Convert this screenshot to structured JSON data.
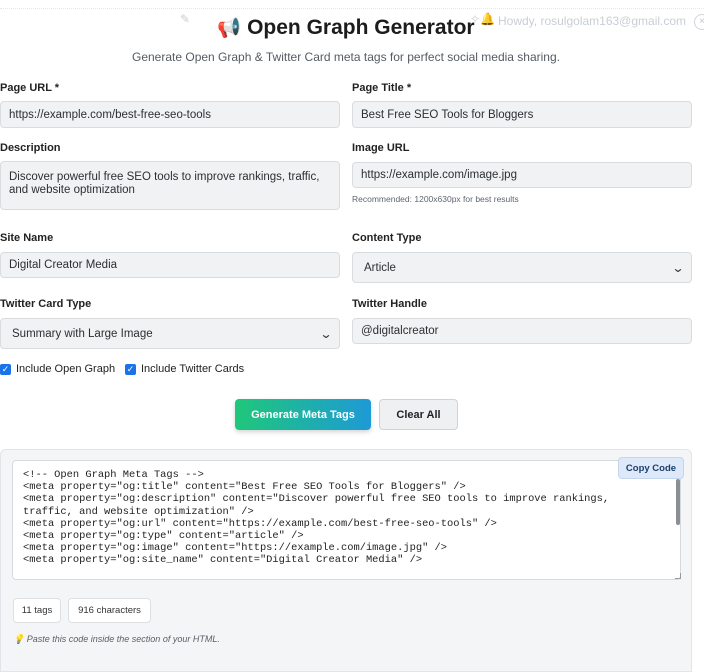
{
  "page": {
    "title": "Open Graph Generator",
    "title_icon": "📢",
    "subtitle": "Generate Open Graph & Twitter Card meta tags for perfect social media sharing.",
    "account_text": "Howdy, rosulgolam163@gmail.com"
  },
  "fields": {
    "page_url": {
      "label": "Page URL *",
      "value": "https://example.com/best-free-seo-tools"
    },
    "page_title": {
      "label": "Page Title *",
      "value": "Best Free SEO Tools for Bloggers"
    },
    "description": {
      "label": "Description",
      "value": "Discover powerful free SEO tools to improve rankings, traffic, and website optimization"
    },
    "image_url": {
      "label": "Image URL",
      "value": "https://example.com/image.jpg",
      "hint": "Recommended: 1200x630px for best results"
    },
    "site_name": {
      "label": "Site Name",
      "value": "Digital Creator Media"
    },
    "content_type": {
      "label": "Content Type",
      "value": "Article"
    },
    "twitter_card_type": {
      "label": "Twitter Card Type",
      "value": "Summary with Large Image"
    },
    "twitter_handle": {
      "label": "Twitter Handle",
      "value": "@digitalcreator"
    }
  },
  "checkboxes": {
    "open_graph": {
      "label": "Include Open Graph",
      "checked": true
    },
    "twitter_cards": {
      "label": "Include Twitter Cards",
      "checked": true
    }
  },
  "buttons": {
    "generate": "Generate Meta Tags",
    "clear": "Clear All",
    "copy": "Copy Code"
  },
  "output": {
    "code": "<!-- Open Graph Meta Tags -->\n<meta property=\"og:title\" content=\"Best Free SEO Tools for Bloggers\" />\n<meta property=\"og:description\" content=\"Discover powerful free SEO tools to improve rankings,\ntraffic, and website optimization\" />\n<meta property=\"og:url\" content=\"https://example.com/best-free-seo-tools\" />\n<meta property=\"og:type\" content=\"article\" />\n<meta property=\"og:image\" content=\"https://example.com/image.jpg\" />\n<meta property=\"og:site_name\" content=\"Digital Creator Media\" />\n\n<!-- Twitter Card Meta Tags -->",
    "tag_count": "11 tags",
    "char_count": "916 characters",
    "tip_icon": "💡",
    "tip": "Paste this code inside the section of your HTML."
  },
  "colors": {
    "accent_blue": "#1a73e8",
    "gradient_start": "#1fc77a",
    "gradient_end": "#1e9ad6"
  }
}
